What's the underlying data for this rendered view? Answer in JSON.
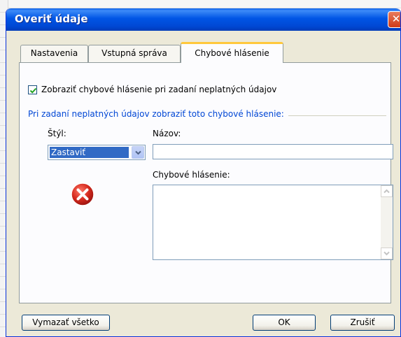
{
  "window": {
    "title": "Overiť údaje",
    "close_glyph": "✕"
  },
  "tabs": [
    {
      "label": "Nastavenia",
      "active": false
    },
    {
      "label": "Vstupná správa",
      "active": false
    },
    {
      "label": "Chybové hlásenie",
      "active": true
    }
  ],
  "panel": {
    "show_alert_checkbox": {
      "label": "Zobraziť chybové hlásenie pri zadaní neplatných údajov",
      "checked": true
    },
    "group_label": "Pri zadaní neplatných údajov zobraziť toto chybové hlásenie:",
    "style_label": "Štýl:",
    "style_value": "Zastaviť",
    "title_label": "Názov:",
    "title_value": "",
    "message_label": "Chybové hlásenie:",
    "message_value": "",
    "icon": "error-stop-icon"
  },
  "buttons": {
    "clear_all": "Vymazať všetko",
    "ok": "OK",
    "cancel": "Zrušiť"
  },
  "colors": {
    "titlebar": "#0055e5",
    "dialog_bg": "#ece9d8",
    "accent_blue": "#0046d5",
    "error_red": "#d52a1e",
    "selection": "#316ac5"
  }
}
